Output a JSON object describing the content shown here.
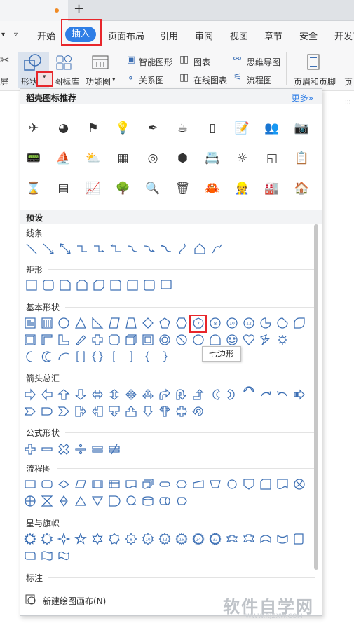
{
  "tabbar": {
    "new_tab": "+"
  },
  "ribbon": {
    "tabs": [
      "开始",
      "插入",
      "页面布局",
      "引用",
      "审阅",
      "视图",
      "章节",
      "安全",
      "开发工"
    ]
  },
  "toolbar": {
    "shape": "形状",
    "shape_arrow": "▾",
    "iconlib": "图标库",
    "funcchart": "功能图",
    "funcchart_arrow": "▾",
    "smartart": "智能图形",
    "chart": "图表",
    "mindmap": "思维导图",
    "relation": "关系图",
    "onlinechart": "在线图表",
    "flowchart": "流程图",
    "headerfooter": "页眉和页脚",
    "left_cut": "屏",
    "right_cut": "页"
  },
  "panel": {
    "rec_title": "稻壳图标推荐",
    "more": "更多»",
    "preset": "预设",
    "categories": {
      "lines": "线条",
      "rect": "矩形",
      "basic": "基本形状",
      "arrows": "箭头总汇",
      "formula": "公式形状",
      "flow": "流程图",
      "stars": "星与旗帜",
      "callout": "标注"
    },
    "rec_icons": [
      "✈",
      "◕",
      "⚑",
      "💡",
      "✒",
      "☕",
      "▯",
      "📝",
      "👥",
      "📷",
      "📟",
      "⛵",
      "⛅",
      "▦",
      "◎",
      "⬢",
      "📇",
      "☼",
      "◱",
      "📋",
      "⌛",
      "▤",
      "📈",
      "🌳",
      "🔍",
      "🗑",
      "🦀",
      "👷",
      "🏭",
      "🏠"
    ],
    "new_canvas": "新建绘图画布(N)"
  },
  "tooltip": "七边形",
  "watermark": {
    "main": "软件自学网",
    "sub": "WWW.RJZXW.COM"
  },
  "colors": {
    "accent": "#2f7ee6",
    "highlight": "#e8262b",
    "shape_stroke": "#3c6fb4"
  }
}
